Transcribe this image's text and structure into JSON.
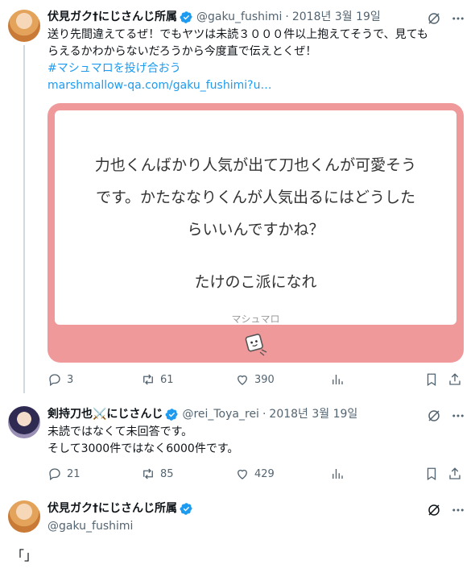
{
  "tweet1": {
    "name": "伏見ガク†にじさんじ所属",
    "handle": "@gaku_fushimi",
    "date": "2018년 3월 19일",
    "text_line1": "送り先間違えてるぜ！でもヤツは未読３０００件以上抱えてそうで、見ても",
    "text_line2": "らえるかわからないだろうから今度直で伝えとくぜ！",
    "hashtag": "#マシュマロを投げ合おう",
    "link": "marshmallow-qa.com/gaku_fushimi?u…",
    "card": {
      "question_line1": "力也くんばかり人気が出て刀也くんが可愛そう",
      "question_line2": "です。かたななりくんが人気出るにはどうした",
      "question_line3": "らいいんですかね？",
      "answer": "たけのこ派になれ",
      "brand": "マシュマロ"
    },
    "replies": "3",
    "retweets": "61",
    "likes": "390"
  },
  "tweet2": {
    "name": "剣持刀也⚔️にじさんじ",
    "handle": "@rei_Toya_rei",
    "date": "2018년 3월 19일",
    "text_line1": "未読ではなくて未回答です。",
    "text_line2": "そして3000件ではなく6000件です。",
    "replies": "21",
    "retweets": "85",
    "likes": "429"
  },
  "tweet3": {
    "name": "伏見ガク†にじさんじ所属",
    "handle": "@gaku_fushimi",
    "text": "「」"
  },
  "colors": {
    "accent": "#1d9bf0",
    "card_border": "#f0999a",
    "muted": "#536471"
  }
}
